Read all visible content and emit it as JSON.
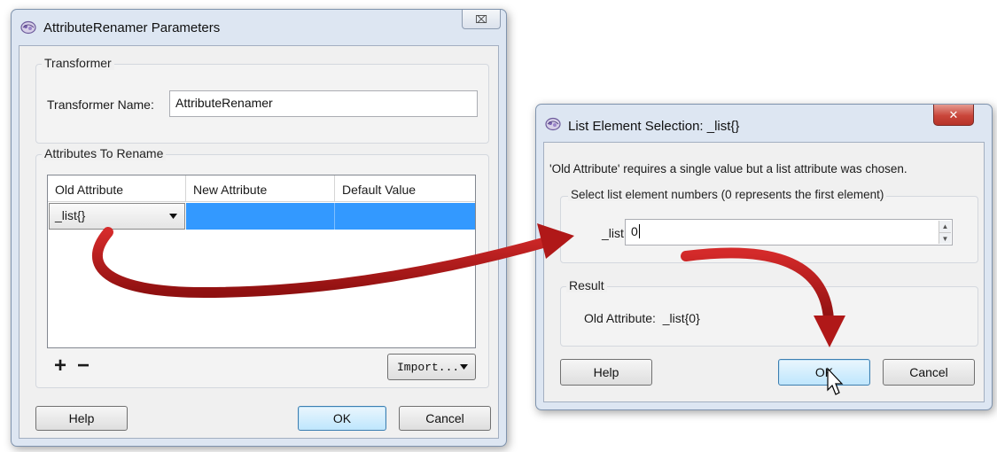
{
  "left_dialog": {
    "title": "AttributeRenamer Parameters",
    "close_glyph": "⌧",
    "transformer_group": {
      "label": "Transformer",
      "name_label": "Transformer Name:",
      "name_value": "AttributeRenamer"
    },
    "attributes_group": {
      "label": "Attributes To Rename",
      "columns": [
        "Old Attribute",
        "New Attribute",
        "Default Value"
      ],
      "rows": [
        {
          "old_attribute": "_list{}",
          "new_attribute": "",
          "default_value": ""
        }
      ],
      "add_glyph": "+",
      "remove_glyph": "−",
      "import_label": "Import..."
    },
    "buttons": {
      "help": "Help",
      "ok": "OK",
      "cancel": "Cancel"
    }
  },
  "right_dialog": {
    "title": "List Element Selection: _list{}",
    "close_glyph": "✕",
    "message": "'Old Attribute' requires a single value but a list attribute was chosen.",
    "selection_group": {
      "label": "Select list element numbers (0 represents the first element)",
      "field_label": "_list:",
      "field_value": "0"
    },
    "result_group": {
      "label": "Result",
      "text": "Old Attribute:  _list{0}"
    },
    "buttons": {
      "help": "Help",
      "ok": "OK",
      "cancel": "Cancel"
    }
  },
  "colors": {
    "arrow": "#b01818",
    "selection": "#3399ff",
    "close_red": "#c9453a"
  },
  "icons": [
    "app-logo-icon",
    "close-icon",
    "dropdown-arrow-icon",
    "spinner-up-icon",
    "spinner-down-icon",
    "mouse-cursor-icon",
    "annotation-arrow"
  ]
}
